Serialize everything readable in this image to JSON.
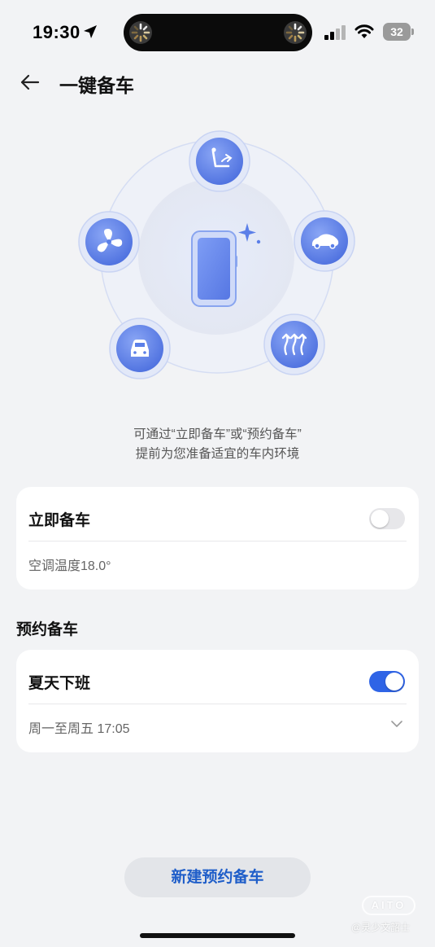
{
  "status_bar": {
    "time": "19:30",
    "battery": "32"
  },
  "header": {
    "title": "一键备车"
  },
  "hero": {
    "icons": [
      "seat-icon",
      "steering-heat-icon",
      "car-front-icon",
      "defrost-icon",
      "car-side-icon"
    ],
    "accent_color": "#5b7fe8"
  },
  "description": {
    "line1": "可通过“立即备车”或“预约备车”",
    "line2": "提前为您准备适宜的车内环境"
  },
  "immediate": {
    "title": "立即备车",
    "toggle_on": false,
    "detail": "空调温度18.0°"
  },
  "scheduled": {
    "section_label": "预约备车",
    "items": [
      {
        "title": "夏天下班",
        "toggle_on": true,
        "schedule": "周一至周五 17:05"
      }
    ]
  },
  "new_button": {
    "label": "新建预约备车"
  },
  "watermark": {
    "logo": "AITO",
    "text": "@灵少文韶士"
  },
  "colors": {
    "accent": "#2f64e6",
    "background": "#f2f3f5"
  }
}
